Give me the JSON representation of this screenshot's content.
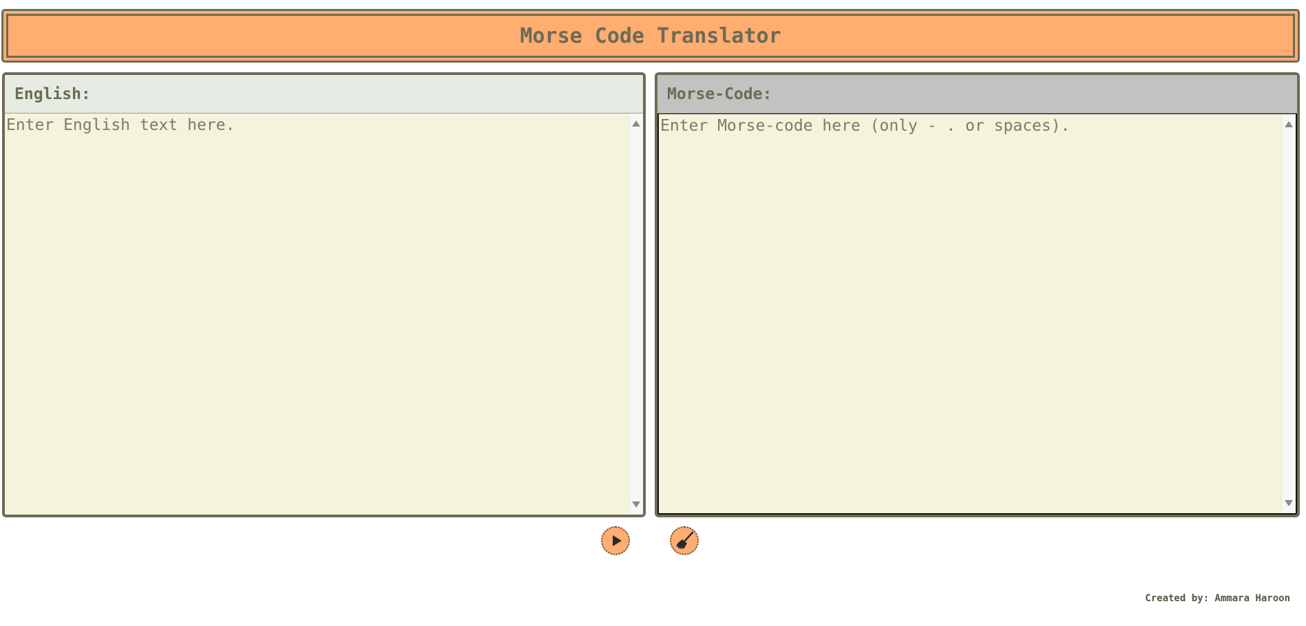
{
  "header": {
    "title": "Morse Code Translator"
  },
  "english_panel": {
    "label": "English:",
    "value": "",
    "placeholder": "Enter English text here."
  },
  "morse_panel": {
    "label": "Morse-Code:",
    "value": "",
    "placeholder": "Enter Morse-code here (only - . or spaces)."
  },
  "controls": {
    "translate_icon": "play-icon",
    "clear_icon": "broom-icon"
  },
  "footer": {
    "credit": "Created by: Ammara Haroon"
  },
  "colors": {
    "accent": "#ffad70",
    "border": "#6d6b55",
    "textarea_bg": "#f4f4dc",
    "english_header_bg": "#e6ece4",
    "morse_header_bg": "#c2c3c0"
  }
}
